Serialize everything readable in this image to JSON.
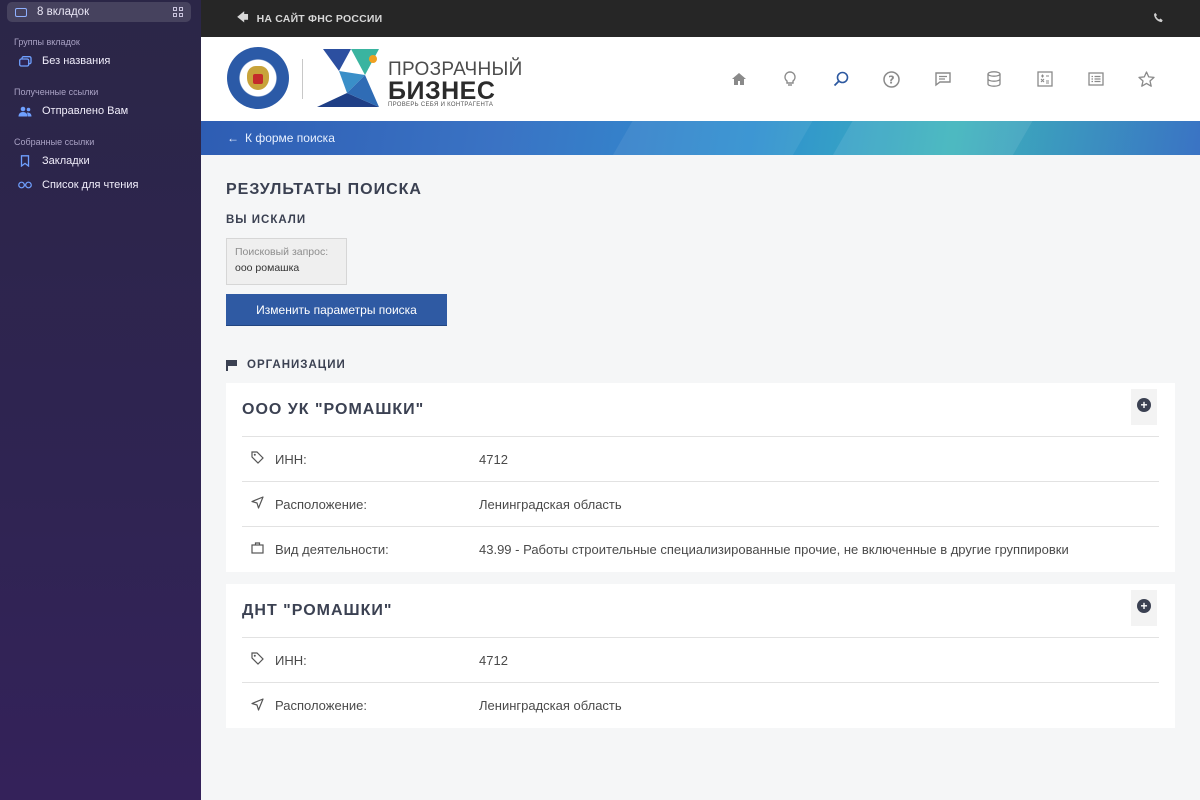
{
  "sidebar": {
    "tabs_label": "8 вкладок",
    "groups_title": "Группы вкладок",
    "group_untitled": "Без названия",
    "received_title": "Полученные ссылки",
    "sent_to_you": "Отправлено Вам",
    "collected_title": "Собранные ссылки",
    "bookmarks": "Закладки",
    "reading_list": "Список для чтения"
  },
  "topbar": {
    "back_label": "НА САЙТ ФНС РОССИИ"
  },
  "header": {
    "brand_line1": "ПРОЗРАЧНЫЙ",
    "brand_line2": "БИЗНЕС",
    "brand_tagline": "ПРОВЕРЬ СЕБЯ И КОНТРАГЕНТА",
    "nav_icons": [
      "home-icon",
      "lightbulb-icon",
      "search-icon",
      "help-icon",
      "chat-icon",
      "database-icon",
      "calculator-icon",
      "list-icon",
      "star-icon"
    ]
  },
  "banner": {
    "back_label": "К форме поиска"
  },
  "results": {
    "title": "РЕЗУЛЬТАТЫ ПОИСКА",
    "searched_title": "ВЫ ИСКАЛИ",
    "query_label": "Поисковый запрос:",
    "query_value": "ооо ромашка",
    "change_button": "Изменить параметры поиска",
    "orgs_title": "ОРГАНИЗАЦИИ"
  },
  "orgs": [
    {
      "name": "ООО УК \"РОМАШКИ\"",
      "inn_label": "ИНН:",
      "inn": "4712",
      "location_label": "Расположение:",
      "location": "Ленинградская область",
      "activity_label": "Вид деятельности:",
      "activity": "43.99 - Работы строительные специализированные прочие, не включенные в другие группировки"
    },
    {
      "name": "ДНТ \"РОМАШКИ\"",
      "inn_label": "ИНН:",
      "inn": "4712",
      "location_label": "Расположение:",
      "location": "Ленинградская область"
    }
  ],
  "colors": {
    "accent": "#2f5aa3",
    "heading": "#3b4152",
    "sidebar_bg": "#2f2452"
  }
}
